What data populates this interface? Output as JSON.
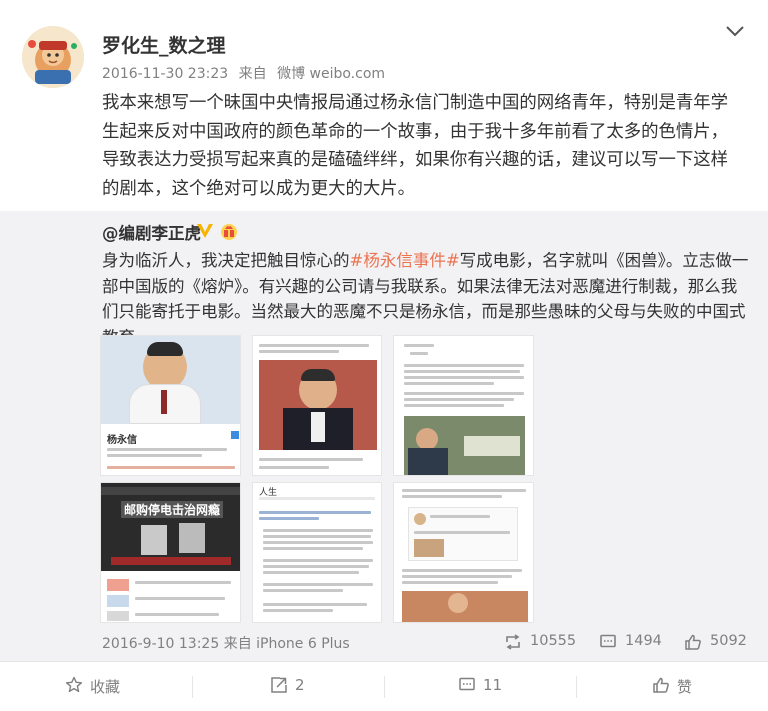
{
  "post": {
    "author": "罗化生_数之理",
    "timestamp": "2016-11-30 23:23",
    "source_prefix": "来自",
    "source": "微博 weibo.com",
    "text": "我本来想写一个昧国中央情报局通过杨永信门制造中国的网络青年，特别是青年学生起来反对中国政府的颜色革命的一个故事，由于我十多年前看了太多的色情片，导致表达力受损写起来真的是磕磕绊绊，如果你有兴趣的话，建议可以写一下这样的剧本，这个绝对可以成为更大的大片。"
  },
  "repost": {
    "author": "@编剧李正虎",
    "text_before": "身为临沂人，我决定把触目惊心的",
    "topic": "#杨永信事件#",
    "text_after": "写成电影，名字就叫《困兽》。立志做一部中国版的《熔炉》。有兴趣的公司请与我联系。如果法律无法对恶魔进行制裁，那么我们只能寄托于电影。当然最大的恶魔不只是杨永信，而是那些愚昧的父母与失败的中国式教育。",
    "thumb_captions": {
      "t1": "杨永信",
      "t4_banner": "邮购停电击治网瘾",
      "t5_header": "人生"
    },
    "time": "2016-9-10 13:25",
    "source_prefix": "来自",
    "source": "iPhone 6 Plus",
    "reposts": "10555",
    "comments": "1494",
    "likes": "5092"
  },
  "actions": {
    "favorite": "收藏",
    "repost_count": "2",
    "comment_count": "11",
    "like": "赞"
  },
  "colors": {
    "topic": "#eb7350",
    "repost_bg": "#f2f2f5",
    "meta": "#808080",
    "vip": "#f7b500"
  },
  "icons": {
    "menu": "chevron-down-icon",
    "verified": "verified-badge-icon",
    "gift": "gift-badge-icon",
    "repost": "repost-icon",
    "comment": "comment-icon",
    "like": "like-icon",
    "favorite": "star-icon"
  }
}
